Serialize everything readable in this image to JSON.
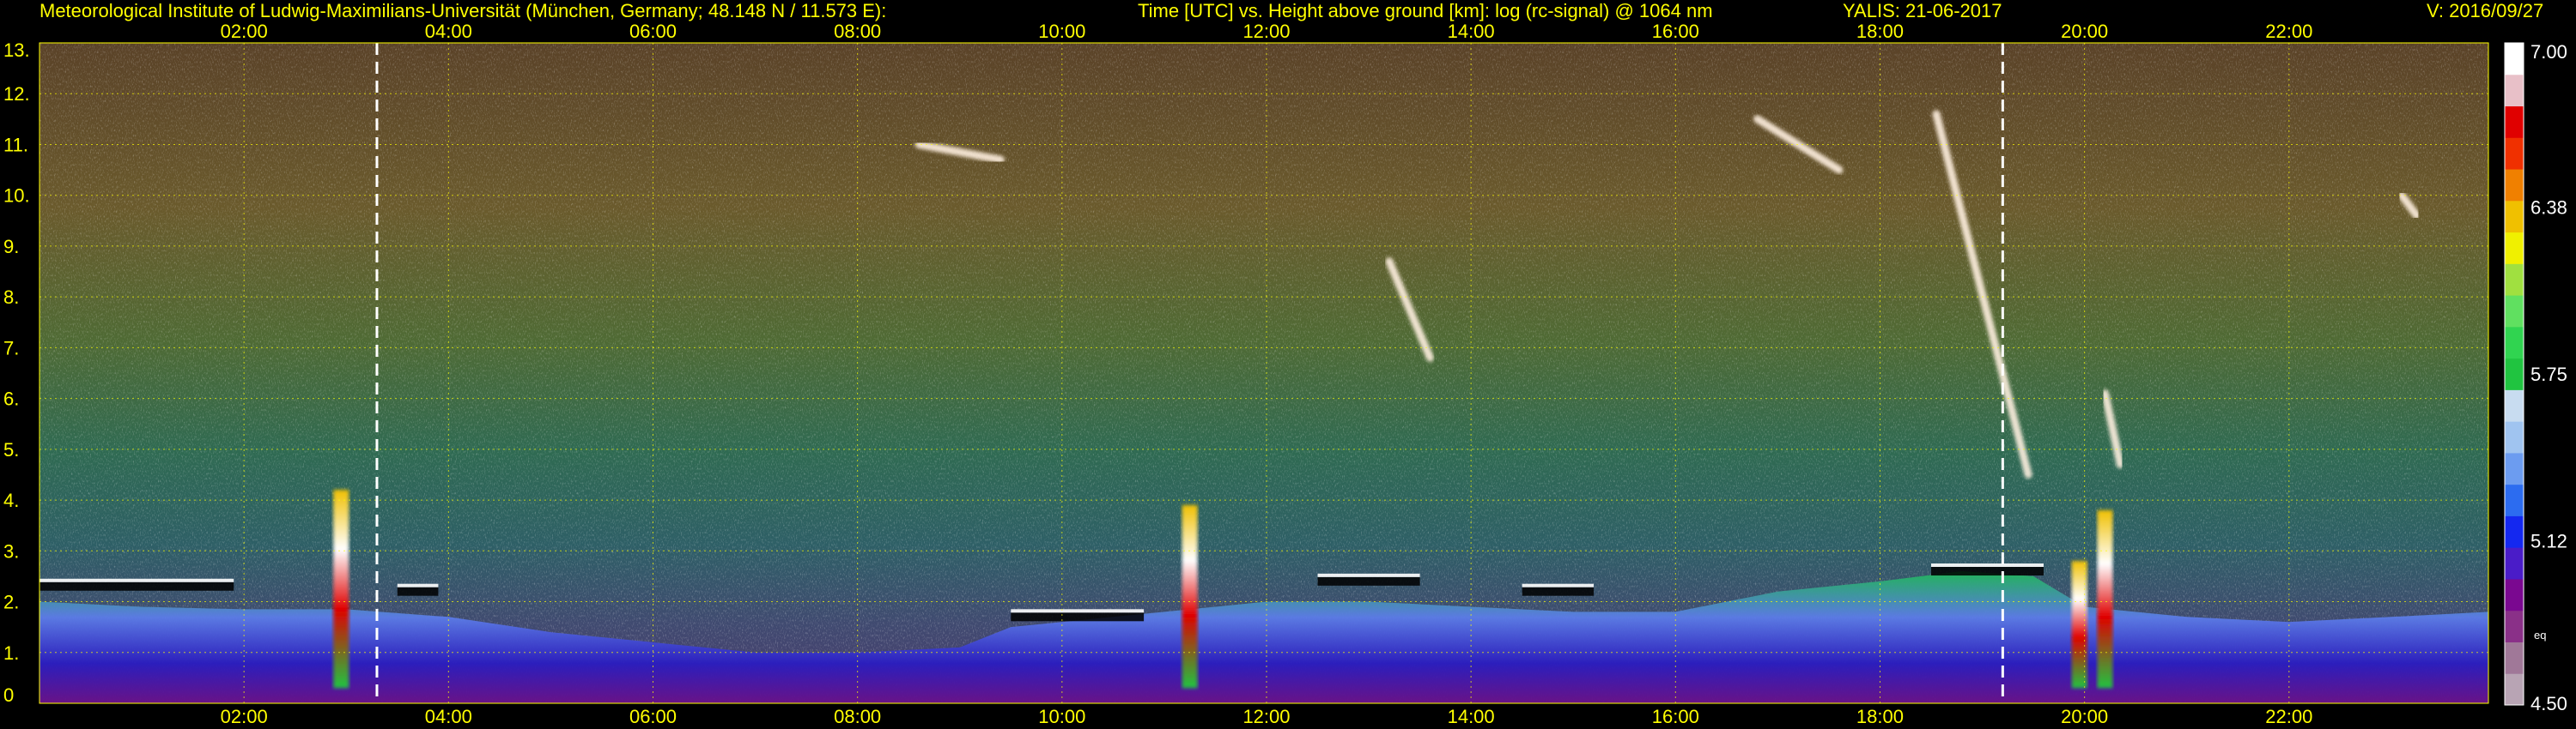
{
  "header": {
    "institute": "Meteorological Institute of Ludwig-Maximilians-Universität (München, Germany; 48.148 N / 11.573 E):",
    "plot_description": "Time [UTC] vs. Height above ground [km]: log (rc-signal) @ 1064 nm",
    "instrument_date": "YALIS: 21-06-2017",
    "version": "V: 2016/09/27"
  },
  "colors": {
    "background": "#000000",
    "text": "#ffff00",
    "grid": "#ffff00",
    "marker": "#ffffff"
  },
  "chart_data": {
    "type": "heatmap",
    "title": "Time [UTC] vs. Height above ground [km]: log (rc-signal) @ 1064 nm",
    "x": {
      "unit": "hours UTC",
      "range": [
        0.0,
        23.95
      ],
      "ticks": [
        2,
        4,
        6,
        8,
        10,
        12,
        14,
        16,
        18,
        20,
        22
      ],
      "tick_labels": [
        "02:00",
        "04:00",
        "06:00",
        "08:00",
        "10:00",
        "12:00",
        "14:00",
        "16:00",
        "18:00",
        "20:00",
        "22:00"
      ]
    },
    "y": {
      "unit": "km",
      "range": [
        0,
        13
      ],
      "ticks": [
        0,
        1,
        2,
        3,
        4,
        5,
        6,
        7,
        8,
        9,
        10,
        11,
        12,
        13
      ],
      "tick_labels": [
        "0",
        "1.",
        "2.",
        "3.",
        "4.",
        "5.",
        "6.",
        "7.",
        "8.",
        "9.",
        "10.",
        "11.",
        "12.",
        "13."
      ]
    },
    "grid": true,
    "colorbar": {
      "range": [
        4.5,
        7.0
      ],
      "tick_values": [
        4.5,
        5.12,
        5.75,
        6.38,
        7.0
      ],
      "tick_labels": [
        "4.50",
        "5.12",
        "5.75",
        "6.38",
        "7.00"
      ],
      "extra_label": "eq",
      "colors": [
        "#b8a4b4",
        "#a07898",
        "#8a3088",
        "#7a0890",
        "#4a1cc8",
        "#1428f0",
        "#2c6cf0",
        "#6c9cf0",
        "#a0c4f0",
        "#c8dcf0",
        "#20c440",
        "#30d450",
        "#60e060",
        "#a0e040",
        "#f0f000",
        "#f0c000",
        "#f08000",
        "#f03000",
        "#e00000",
        "#e8c0c8",
        "#ffffff"
      ]
    },
    "markers_hours": [
      3.3,
      19.2
    ],
    "features": {
      "boundary_layer": {
        "times": [
          0.0,
          1.0,
          2.0,
          3.0,
          4.0,
          5.0,
          6.0,
          7.0,
          8.0,
          9.0,
          9.5,
          10.0,
          10.5,
          11.0,
          11.5,
          12.0,
          13.0,
          14.0,
          15.0,
          16.0,
          17.0,
          18.0,
          18.8,
          19.5,
          20.0,
          21.0,
          22.0,
          23.0,
          23.95
        ],
        "top_km": [
          2.0,
          1.9,
          1.85,
          1.85,
          1.7,
          1.4,
          1.2,
          1.0,
          1.0,
          1.1,
          1.5,
          1.6,
          1.7,
          1.8,
          1.9,
          2.0,
          2.0,
          1.9,
          1.8,
          1.8,
          2.2,
          2.4,
          2.6,
          2.5,
          1.9,
          1.7,
          1.6,
          1.7,
          1.8
        ]
      },
      "cloud_tops_km": [
        {
          "times": [
            0.0,
            1.9
          ],
          "top_km": 2.3
        },
        {
          "times": [
            3.5,
            3.9
          ],
          "top_km": 2.2
        },
        {
          "times": [
            9.5,
            10.8
          ],
          "top_km": 1.7
        },
        {
          "times": [
            12.5,
            13.5
          ],
          "top_km": 2.4
        },
        {
          "times": [
            14.5,
            15.2
          ],
          "top_km": 2.2
        },
        {
          "times": [
            18.5,
            19.6
          ],
          "top_km": 2.6
        }
      ],
      "precipitation_streaks": [
        {
          "time": 2.95,
          "bottom_km": 0.3,
          "top_km": 4.2
        },
        {
          "time": 11.25,
          "bottom_km": 0.3,
          "top_km": 3.9
        },
        {
          "time": 19.95,
          "bottom_km": 0.3,
          "top_km": 2.8
        },
        {
          "time": 20.2,
          "bottom_km": 0.3,
          "top_km": 3.8
        }
      ],
      "cirrus": [
        {
          "t0": 18.55,
          "t1": 19.45,
          "top_km": 11.6,
          "bottom_km": 4.5
        },
        {
          "t0": 13.2,
          "t1": 13.6,
          "top_km": 8.7,
          "bottom_km": 6.8
        },
        {
          "t0": 20.2,
          "t1": 20.35,
          "top_km": 6.1,
          "bottom_km": 4.7
        },
        {
          "t0": 16.8,
          "t1": 17.6,
          "top_km": 11.5,
          "bottom_km": 10.5
        },
        {
          "t0": 23.1,
          "t1": 23.25,
          "top_km": 10.0,
          "bottom_km": 9.6
        },
        {
          "t0": 8.6,
          "t1": 9.4,
          "top_km": 11.0,
          "bottom_km": 10.7
        }
      ]
    }
  }
}
